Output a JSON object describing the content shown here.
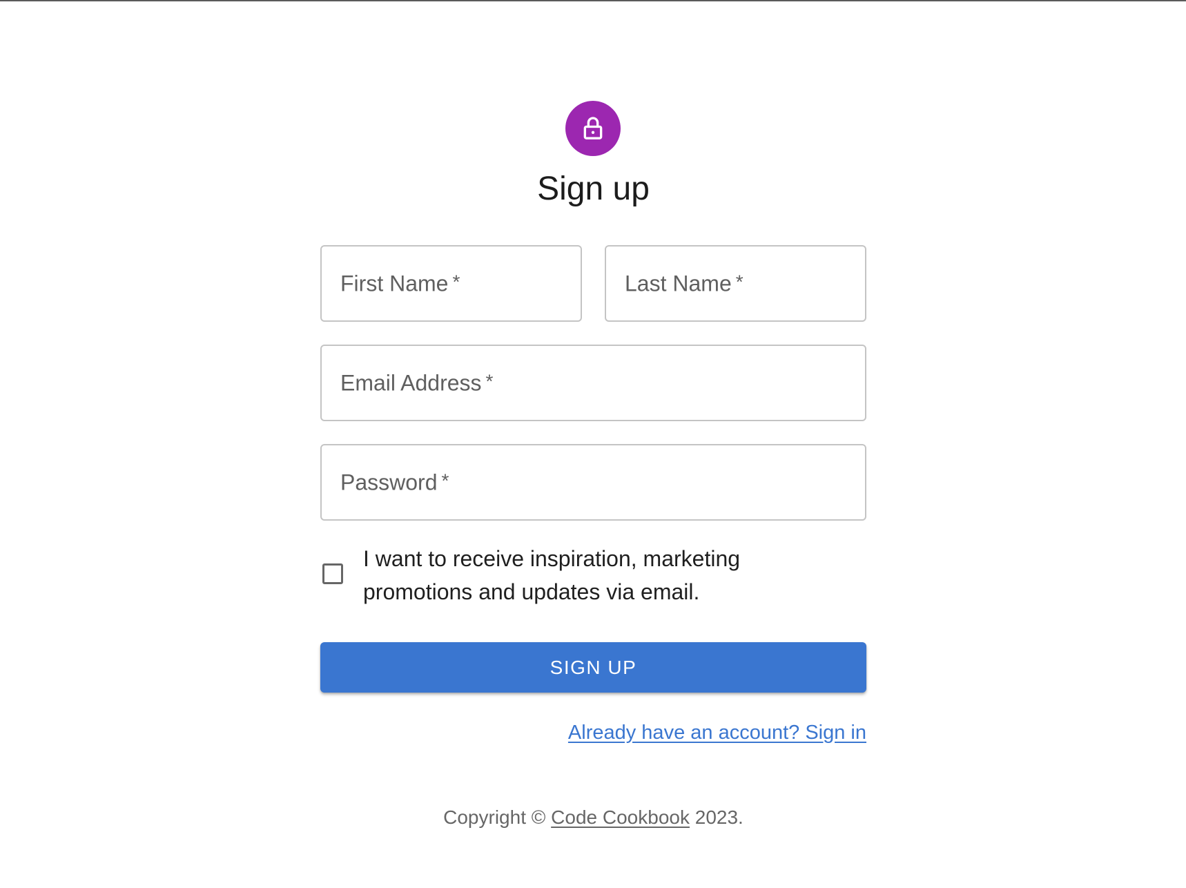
{
  "page": {
    "title": "Sign up"
  },
  "avatar": {
    "icon": "lock-outline-icon",
    "color": "#9c27b0"
  },
  "form": {
    "first_name": {
      "label": "First Name",
      "required_marker": "*",
      "value": ""
    },
    "last_name": {
      "label": "Last Name",
      "required_marker": "*",
      "value": ""
    },
    "email": {
      "label": "Email Address",
      "required_marker": "*",
      "value": ""
    },
    "password": {
      "label": "Password",
      "required_marker": "*",
      "value": ""
    },
    "marketing_opt_in": {
      "label": "I want to receive inspiration, marketing promotions and updates via email.",
      "checked": false
    },
    "submit_label": "SIGN UP",
    "signin_link": "Already have an account? Sign in"
  },
  "footer": {
    "prefix": "Copyright ©",
    "link_text": "Code Cookbook",
    "suffix": "2023."
  },
  "colors": {
    "primary": "#3a76d0",
    "avatar_bg": "#9c27b0",
    "border": "#c4c4c4",
    "muted_text": "#666666"
  }
}
